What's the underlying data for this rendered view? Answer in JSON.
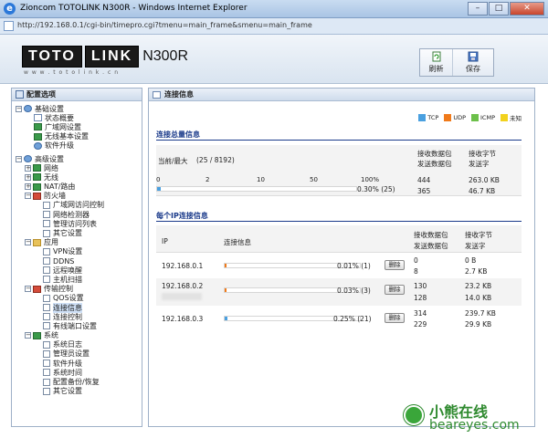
{
  "window": {
    "title": "Zioncom TOTOLINK N300R - Windows Internet Explorer",
    "url": "http://192.168.0.1/cgi-bin/timepro.cgi?tmenu=main_frame&smenu=main_frame"
  },
  "header": {
    "logo_part1": "TOTO",
    "logo_part2": "LINK",
    "model": "N300R",
    "logo_url": "w w w . t o t o l i n k . c n",
    "refresh_label": "刷新",
    "save_label": "保存"
  },
  "sidebar": {
    "title": "配置选项",
    "groups": [
      {
        "label": "基础设置",
        "items": [
          "状态概要",
          "广域网设置",
          "无线基本设置",
          "软件升级"
        ]
      },
      {
        "label": "高级设置",
        "sub": [
          {
            "label": "网络"
          },
          {
            "label": "无线"
          },
          {
            "label": "NAT/路由"
          },
          {
            "label": "防火墙",
            "items": [
              "广域网访问控制",
              "网络检测器",
              "管理访问列表",
              "其它设置"
            ]
          },
          {
            "label": "应用",
            "items": [
              "VPN设置",
              "DDNS",
              "远程唤醒",
              "主机扫描"
            ]
          },
          {
            "label": "传输控制",
            "items": [
              "QOS设置",
              "连接信息",
              "连接控制",
              "有线端口设置"
            ]
          },
          {
            "label": "系统",
            "items": [
              "系统日志",
              "管理员设置",
              "软件升级",
              "系统时间",
              "配置备份/恢复",
              "其它设置"
            ]
          }
        ]
      }
    ]
  },
  "main": {
    "title": "连接信息",
    "legend": [
      {
        "label": "TCP",
        "color": "#4aa0e0"
      },
      {
        "label": "UDP",
        "color": "#f07a1a"
      },
      {
        "label": "ICMP",
        "color": "#6cc04a"
      },
      {
        "label": "未知",
        "color": "#f2d21e"
      }
    ],
    "summary": {
      "title": "连接总量信息",
      "current_max_label": "当前/最大",
      "current_max_value": "(25 / 8192)",
      "scale": [
        "0",
        "2",
        "10",
        "50",
        "100%"
      ],
      "bar_percent": 0.3,
      "bar_text": "0.30% (25)",
      "col_packets": "接收数据包",
      "col_packets2": "发送数据包",
      "col_bytes": "接收字节",
      "col_bytes2": "发送字",
      "recv_packets": "444",
      "send_packets": "365",
      "recv_bytes": "263.0 KB",
      "send_bytes": "46.7 KB"
    },
    "per_ip": {
      "title": "每个IP连接信息",
      "col_ip": "IP",
      "col_conn": "连接信息",
      "col_packets": "接收数据包",
      "col_packets2": "发送数据包",
      "col_bytes": "接收字节",
      "col_bytes2": "发送字",
      "delete_label": "删除",
      "rows": [
        {
          "ip": "192.168.0.1",
          "percent": 0.01,
          "pct_text": "0.01% (1)",
          "recv_packets": "0",
          "send_packets": "8",
          "recv_bytes": "0 B",
          "send_bytes": "2.7 KB",
          "bar_color": "#f07a1a"
        },
        {
          "ip": "192.168.0.2",
          "percent": 0.03,
          "pct_text": "0.03% (3)",
          "recv_packets": "130",
          "send_packets": "128",
          "recv_bytes": "23.2 KB",
          "send_bytes": "14.0 KB",
          "bar_color": "#f07a1a"
        },
        {
          "ip": "192.168.0.3",
          "percent": 0.25,
          "pct_text": "0.25% (21)",
          "recv_packets": "314",
          "send_packets": "229",
          "recv_bytes": "239.7 KB",
          "send_bytes": "29.9 KB",
          "bar_color": "#4aa0e0"
        }
      ]
    }
  },
  "watermark": {
    "cn": "小熊在线",
    "en": "beareyes.com"
  }
}
